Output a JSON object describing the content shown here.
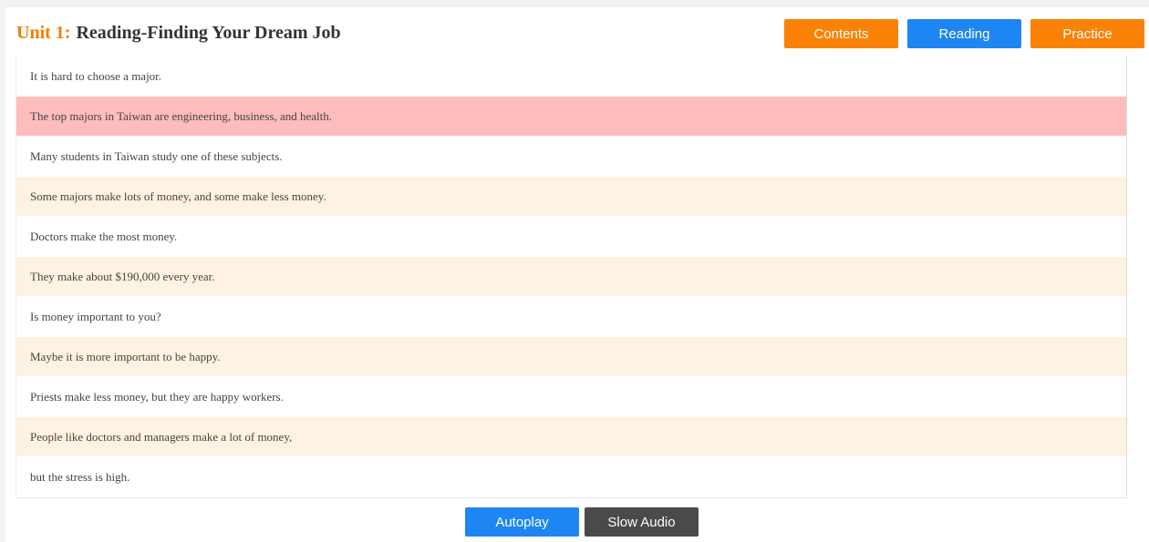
{
  "header": {
    "unit_label": "Unit 1:",
    "title": "Reading-Finding Your Dream Job"
  },
  "nav": {
    "contents_label": "Contents",
    "reading_label": "Reading",
    "practice_label": "Practice"
  },
  "lines": [
    {
      "text": "It is hard to choose a major.",
      "style": "white"
    },
    {
      "text": "The top majors in Taiwan are engineering, business, and health.",
      "style": "pink"
    },
    {
      "text": "Many students in Taiwan study one of these subjects.",
      "style": "white"
    },
    {
      "text": "Some majors make lots of money, and some make less money.",
      "style": "cream"
    },
    {
      "text": "Doctors make the most money.",
      "style": "white"
    },
    {
      "text": "They make about $190,000 every year.",
      "style": "cream"
    },
    {
      "text": "Is money important to you?",
      "style": "white"
    },
    {
      "text": "Maybe it is more important to be happy.",
      "style": "cream"
    },
    {
      "text": "Priests make less money, but they are happy workers.",
      "style": "white"
    },
    {
      "text": "People like doctors and managers make a lot of money,",
      "style": "cream"
    },
    {
      "text": "but the stress is high.",
      "style": "white"
    }
  ],
  "controls": {
    "autoplay_label": "Autoplay",
    "slow_audio_label": "Slow Audio"
  },
  "colors": {
    "accent_orange": "#f98207",
    "accent_blue": "#1d86f2",
    "highlight_pink": "#ffbcbc",
    "row_cream": "#fef3e2",
    "dark_button": "#4a4a4a"
  }
}
